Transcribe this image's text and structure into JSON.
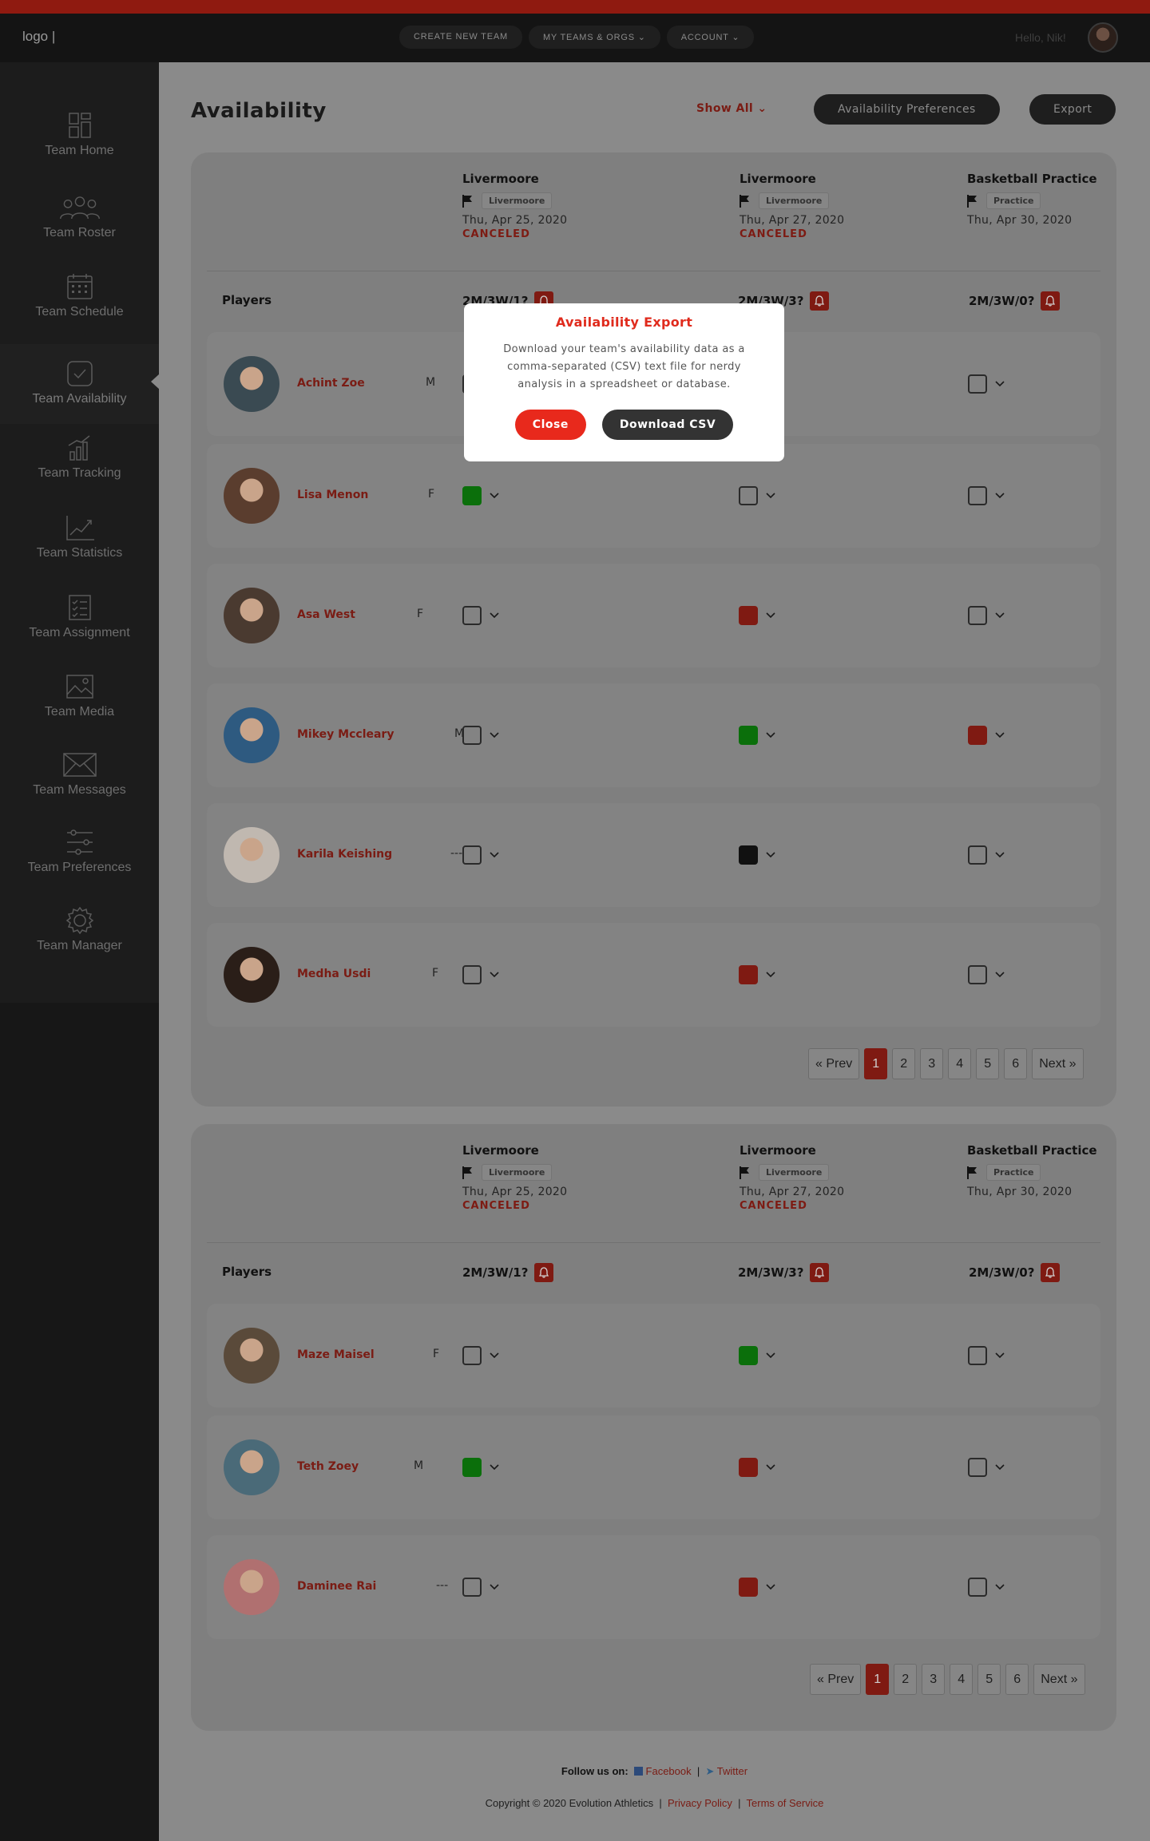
{
  "topbar": {
    "logo": "logo |",
    "nav": [
      "CREATE NEW TEAM",
      "MY TEAMS & ORGS ⌄",
      "ACCOUNT ⌄"
    ],
    "greeting": "Hello, Nik!"
  },
  "sidebar": {
    "items": [
      {
        "label": "Team Home",
        "icon": "dashboard-icon"
      },
      {
        "label": "Team Roster",
        "icon": "group-icon"
      },
      {
        "label": "Team Schedule",
        "icon": "calendar-icon"
      },
      {
        "label": "Team Availability",
        "icon": "checkbox-icon",
        "active": true
      },
      {
        "label": "Team Tracking",
        "icon": "bar-chart-icon"
      },
      {
        "label": "Team Statistics",
        "icon": "line-chart-icon"
      },
      {
        "label": "Team Assignment",
        "icon": "checklist-icon"
      },
      {
        "label": "Team Media",
        "icon": "image-icon"
      },
      {
        "label": "Team Messages",
        "icon": "envelope-icon"
      },
      {
        "label": "Team Preferences",
        "icon": "sliders-icon"
      },
      {
        "label": "Team Manager",
        "icon": "gear-icon"
      }
    ]
  },
  "page": {
    "title": "Availability",
    "show_all": "Show All ⌄",
    "prefs_button": "Availability Preferences",
    "export_button": "Export"
  },
  "events": [
    {
      "title": "Livermoore",
      "location": "Livermoore",
      "date": "Thu, Apr 25, 2020",
      "status": "CANCELED",
      "summary": "2M/3W/1?"
    },
    {
      "title": "Livermoore",
      "location": "Livermoore",
      "date": "Thu, Apr 27, 2020",
      "status": "CANCELED",
      "summary": "2M/3W/3?"
    },
    {
      "title": "Basketball Practice",
      "location": "Practice",
      "date": "Thu, Apr 30, 2020",
      "status": "",
      "summary": "2M/3W/0?"
    }
  ],
  "players_header": "Players",
  "card1_players": [
    {
      "name": "Achint Zoe",
      "gender": "M",
      "avail": [
        "empty",
        "empty",
        "empty"
      ]
    },
    {
      "name": "Lisa Menon",
      "gender": "F",
      "avail": [
        "green",
        "empty",
        "empty"
      ]
    },
    {
      "name": "Asa West",
      "gender": "F",
      "avail": [
        "empty",
        "red",
        "empty"
      ]
    },
    {
      "name": "Mikey Mccleary",
      "gender": "M",
      "avail": [
        "empty",
        "green",
        "red"
      ]
    },
    {
      "name": "Karila Keishing",
      "gender": "---",
      "avail": [
        "empty",
        "black",
        "empty"
      ]
    },
    {
      "name": "Medha Usdi",
      "gender": "F",
      "avail": [
        "empty",
        "red",
        "empty"
      ]
    }
  ],
  "card2_players": [
    {
      "name": "Maze Maisel",
      "gender": "F",
      "avail": [
        "empty",
        "green",
        "empty"
      ]
    },
    {
      "name": "Teth Zoey",
      "gender": "M",
      "avail": [
        "green",
        "red",
        "empty"
      ]
    },
    {
      "name": "Daminee Rai",
      "gender": "---",
      "avail": [
        "empty",
        "red",
        "empty"
      ]
    }
  ],
  "pagination": {
    "prev": "« Prev",
    "pages": [
      "1",
      "2",
      "3",
      "4",
      "5",
      "6"
    ],
    "next": "Next »",
    "current": "1"
  },
  "footer": {
    "follow_label": "Follow us on:",
    "facebook": "Facebook",
    "separator": "|",
    "twitter": "Twitter",
    "copyright": "Copyright © 2020 Evolution Athletics",
    "privacy": "Privacy Policy",
    "terms": "Terms of Service"
  },
  "modal": {
    "title": "Availability Export",
    "text": "Download your team's availability data as a comma-separated (CSV) text file for nerdy analysis in a spreadsheet or database.",
    "close": "Close",
    "download": "Download CSV"
  },
  "colors": {
    "accent": "#e02b1d",
    "available": "#0b6f0b",
    "unavailable": "#7f1a12",
    "overlay": "#8a8a8a"
  }
}
